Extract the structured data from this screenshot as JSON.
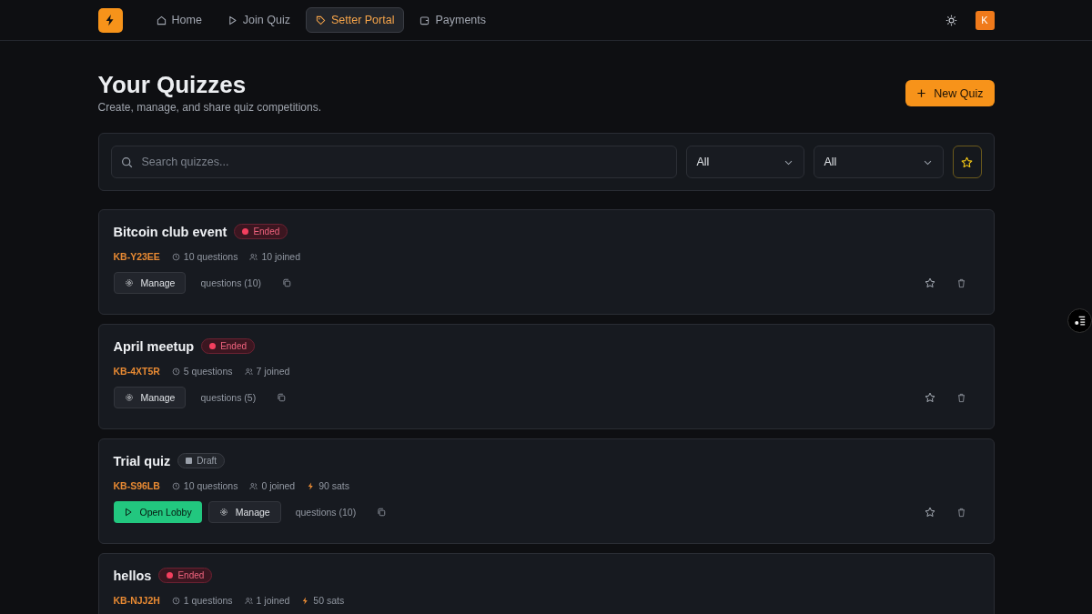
{
  "nav": {
    "links": [
      {
        "label": "Home",
        "selected": false
      },
      {
        "label": "Join Quiz",
        "selected": false
      },
      {
        "label": "Setter Portal",
        "selected": true
      },
      {
        "label": "Payments",
        "selected": false
      }
    ],
    "avatar": "K"
  },
  "header": {
    "title": "Your Quizzes",
    "subtitle": "Create, manage, and share quiz competitions.",
    "new_button": "New Quiz"
  },
  "filters": {
    "search_placeholder": "Search quizzes...",
    "selects": [
      "All",
      "All"
    ],
    "favorites_only": true
  },
  "quizzes": [
    {
      "title": "Bitcoin club event",
      "status": {
        "label": "Ended",
        "kind": "ended"
      },
      "code": "KB-Y23EE",
      "questions": "10 questions",
      "joined": "10 joined",
      "manage": "Manage",
      "questions_link": "questions (10)",
      "favorite": false
    },
    {
      "title": "April meetup",
      "status": {
        "label": "Ended",
        "kind": "ended"
      },
      "code": "KB-4XT5R",
      "questions": "5 questions",
      "joined": "7 joined",
      "manage": "Manage",
      "questions_link": "questions (5)",
      "favorite": false
    },
    {
      "title": "Trial quiz",
      "status": {
        "label": "Draft",
        "kind": "draft"
      },
      "code": "KB-S96LB",
      "questions": "10 questions",
      "joined": "0 joined",
      "reward": "90 sats",
      "open_lobby": "Open Lobby",
      "manage": "Manage",
      "questions_link": "questions (10)",
      "favorite": false
    },
    {
      "title": "hellos",
      "status": {
        "label": "Ended",
        "kind": "ended"
      },
      "code": "KB-NJJ2H",
      "questions": "1 questions",
      "joined": "1 joined",
      "reward": "50 sats"
    }
  ]
}
